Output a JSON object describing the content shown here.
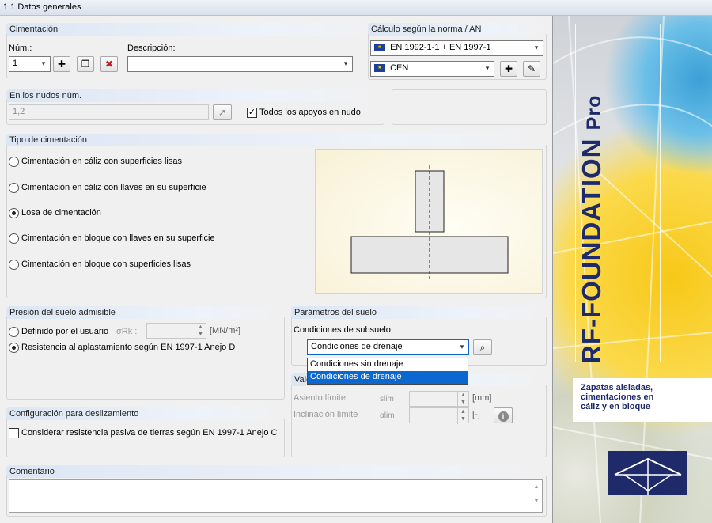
{
  "window": {
    "title": "1.1 Datos generales"
  },
  "cimentacion": {
    "header": "Cimentación",
    "num_label": "Núm.:",
    "num_value": "1",
    "desc_label": "Descripción:",
    "desc_value": ""
  },
  "calculo": {
    "header": "Cálculo según la norma / AN",
    "norma_value": "EN 1992-1-1 + EN 1997-1",
    "anexo_value": "CEN"
  },
  "nudos": {
    "header": "En los nudos núm.",
    "value": "1,2",
    "todos_label": "Todos los apoyos en nudo",
    "todos_checked": true
  },
  "tipo": {
    "header": "Tipo de cimentación",
    "options": [
      {
        "label": "Cimentación en cáliz con superficies lisas",
        "selected": false
      },
      {
        "label": "Cimentación en cáliz con llaves en su superficie",
        "selected": false
      },
      {
        "label": "Losa de cimentación",
        "selected": true
      },
      {
        "label": "Cimentación en bloque con llaves en su superficie",
        "selected": false
      },
      {
        "label": "Cimentación en bloque con superficies lisas",
        "selected": false
      }
    ]
  },
  "presion": {
    "header": "Presión del suelo admisible",
    "opt1": "Definido por el usuario",
    "sigma_label": "σRk :",
    "unit": "[MN/m²]",
    "opt2": "Resistencia al aplastamiento según EN 1997-1 Anejo D"
  },
  "parametros": {
    "header": "Parámetros del suelo",
    "cond_label": "Condiciones de subsuelo:",
    "cond_value": "Condiciones de drenaje",
    "dropdown_options": [
      "Condiciones sin drenaje",
      "Condiciones de drenaje"
    ],
    "dropdown_selected": "Condiciones de drenaje"
  },
  "valores": {
    "header_partial": "Valo",
    "asiento_label": "Asiento límite",
    "asiento_sym": "slim",
    "asiento_unit": "[mm]",
    "inclin_label": "Inclinación límite",
    "inclin_sym": "αlim",
    "inclin_unit": "[-]"
  },
  "deslizamiento": {
    "header": "Configuración para deslizamiento",
    "check_label": "Considerar resistencia pasiva de tierras según EN 1997-1 Anejo C",
    "checked": false
  },
  "comentario": {
    "header": "Comentario",
    "value": ""
  },
  "brand": {
    "title": "RF-FOUNDATION",
    "title_suffix": "Pro",
    "tagline_1": "Zapatas aisladas,",
    "tagline_2": "cimentaciones en",
    "tagline_3": "cáliz y en bloque",
    "accent": "#1e2a6a"
  }
}
